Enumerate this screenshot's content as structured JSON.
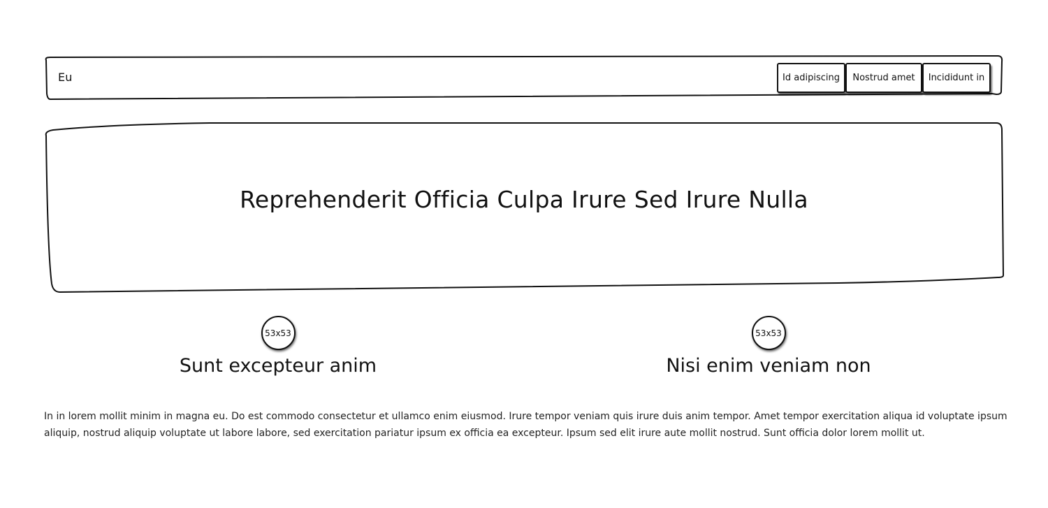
{
  "nav": {
    "brand": "Eu",
    "links": [
      "Id adipiscing",
      "Nostrud amet",
      "Incididunt in"
    ]
  },
  "hero": {
    "title": "Reprehenderit Officia Culpa Irure Sed Irure Nulla"
  },
  "features": [
    {
      "image_label": "53x53",
      "title": "Sunt excepteur anim"
    },
    {
      "image_label": "53x53",
      "title": "Nisi enim veniam non"
    }
  ],
  "body_text": "In in lorem mollit minim in magna eu. Do est commodo consectetur et ullamco enim eiusmod. Irure tempor veniam quis irure duis anim tempor. Amet tempor exercitation aliqua id voluptate ipsum aliquip, nostrud aliquip voluptate ut labore labore, sed exercitation pariatur ipsum ex officia ea excepteur. Ipsum sed elit irure aute mollit nostrud. Sunt officia dolor lorem mollit ut."
}
